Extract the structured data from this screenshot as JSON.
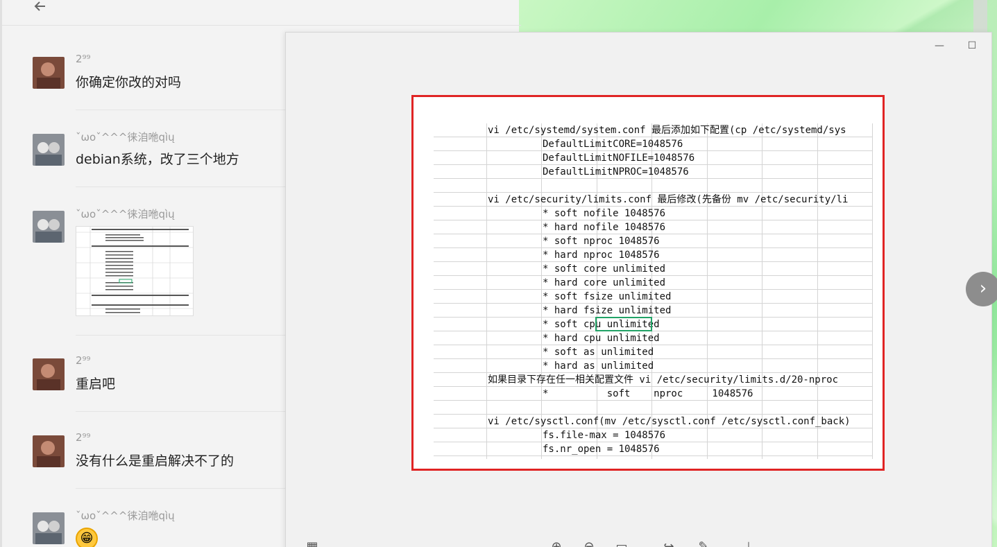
{
  "messages": [
    {
      "name": "2⁹⁹",
      "text": "你确定你改的对吗"
    },
    {
      "name": "ˇωoˇ^^^徕洎咃qìų",
      "text": "debian系统，改了三个地方"
    },
    {
      "name": "ˇωoˇ^^^徕洎咃qìų",
      "text": ""
    },
    {
      "name": "2⁹⁹",
      "text": "重启吧"
    },
    {
      "name": "2⁹⁹",
      "text": "没有什么是重启解决不了的"
    },
    {
      "name": "ˇωoˇ^^^徕洎咃qìų",
      "text": ""
    }
  ],
  "emoji": "😁",
  "window": {
    "minimize": "—",
    "maximize": "☐"
  },
  "sheet_lines": [
    {
      "indent": 0,
      "text": "vi /etc/systemd/system.conf 最后添加如下配置(cp /etc/systemd/sys"
    },
    {
      "indent": 1,
      "text": "DefaultLimitCORE=1048576"
    },
    {
      "indent": 1,
      "text": "DefaultLimitNOFILE=1048576"
    },
    {
      "indent": 1,
      "text": "DefaultLimitNPROC=1048576"
    },
    {
      "indent": 0,
      "text": ""
    },
    {
      "indent": 0,
      "text": "vi /etc/security/limits.conf 最后修改(先备份 mv /etc/security/li"
    },
    {
      "indent": 1,
      "text": "* soft nofile 1048576"
    },
    {
      "indent": 1,
      "text": "* hard nofile 1048576"
    },
    {
      "indent": 1,
      "text": "* soft nproc 1048576"
    },
    {
      "indent": 1,
      "text": "* hard nproc 1048576"
    },
    {
      "indent": 1,
      "text": "* soft core unlimited"
    },
    {
      "indent": 1,
      "text": "* hard core unlimited"
    },
    {
      "indent": 1,
      "text": "* soft fsize unlimited"
    },
    {
      "indent": 1,
      "text": "* hard fsize unlimited"
    },
    {
      "indent": 1,
      "text": "* soft cpu unlimited"
    },
    {
      "indent": 1,
      "text": "* hard cpu unlimited"
    },
    {
      "indent": 1,
      "text": "* soft as unlimited"
    },
    {
      "indent": 1,
      "text": "* hard as unlimited"
    },
    {
      "indent": 0,
      "text": "如果目录下存在任一相关配置文件 vi /etc/security/limits.d/20-nproc"
    },
    {
      "indent": 1,
      "text": "*          soft    nproc     1048576"
    },
    {
      "indent": 0,
      "text": ""
    },
    {
      "indent": 0,
      "text": "vi /etc/sysctl.conf(mv /etc/sysctl.conf /etc/sysctl.conf_back)"
    },
    {
      "indent": 1,
      "text": "fs.file-max = 1048576"
    },
    {
      "indent": 1,
      "text": "fs.nr_open = 1048576"
    }
  ],
  "colors": {
    "highlight_frame": "#e02424",
    "selection": "#21a366"
  }
}
